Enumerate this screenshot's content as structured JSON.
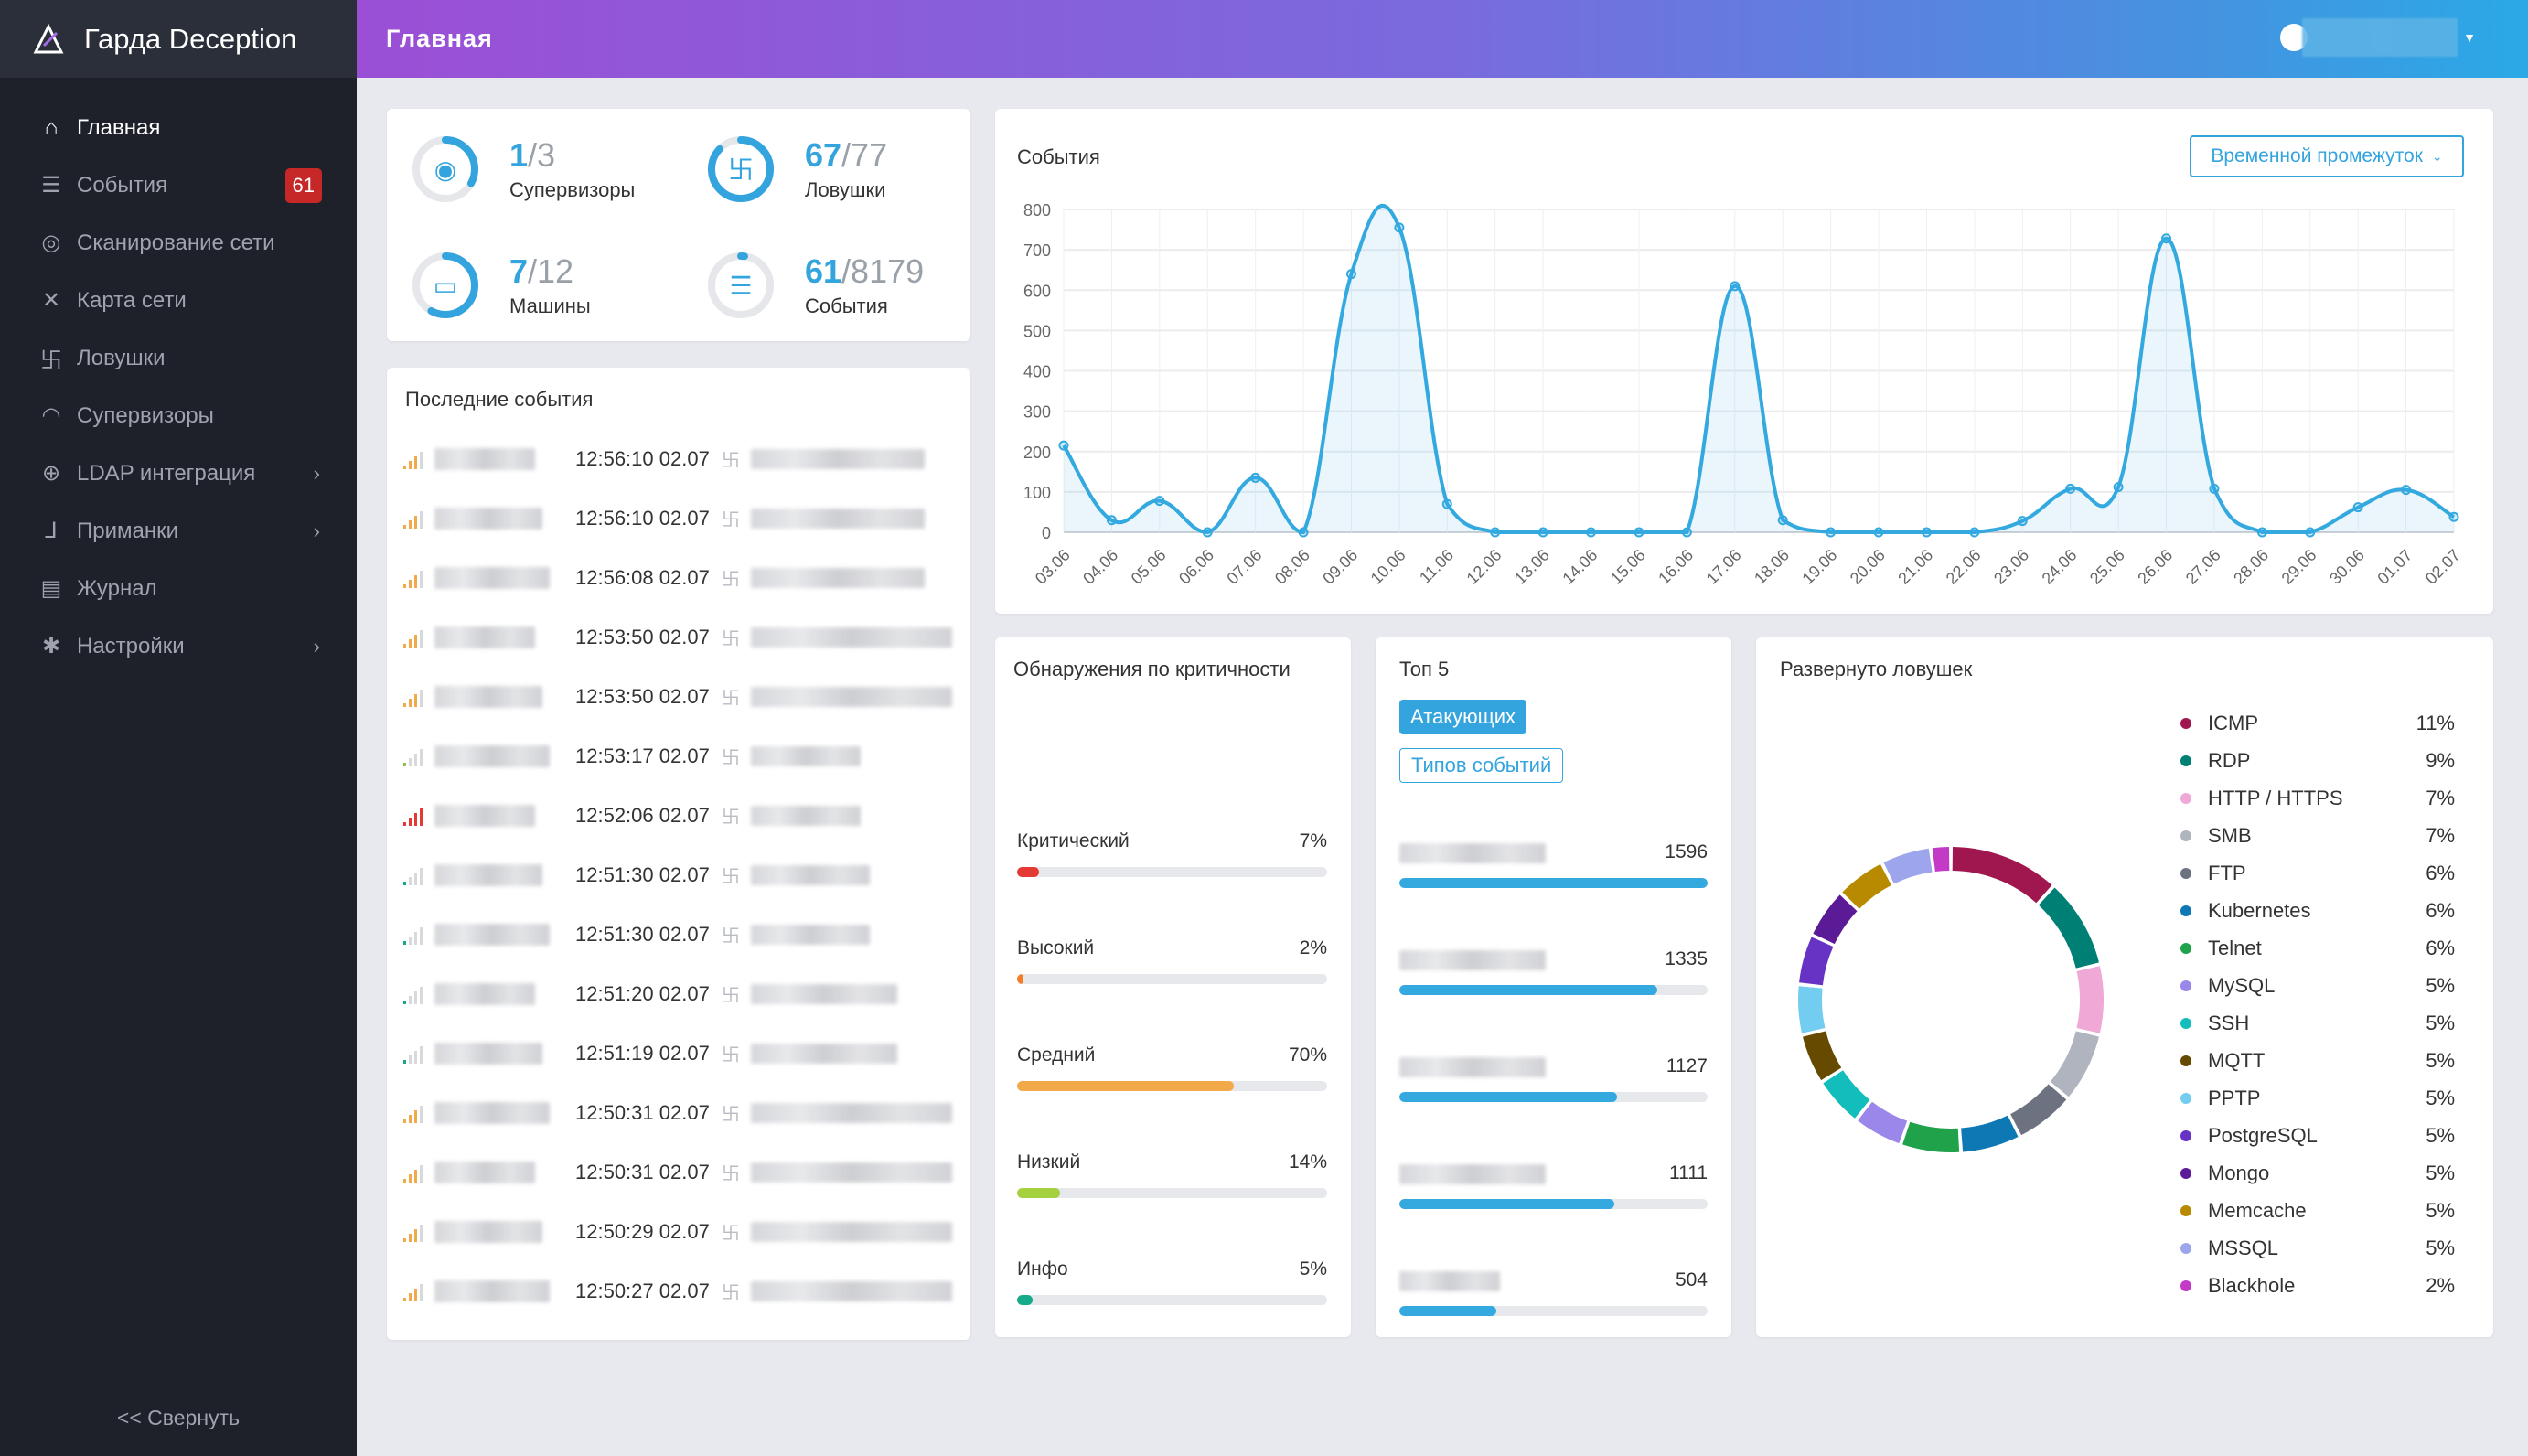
{
  "app": {
    "title": "Гарда Deception"
  },
  "header": {
    "title": "Главная",
    "user_icon": "user-circle-icon"
  },
  "sidebar": {
    "items": [
      {
        "label": "Главная",
        "icon": "home-icon",
        "active": true
      },
      {
        "label": "События",
        "icon": "list-icon",
        "badge": "61"
      },
      {
        "label": "Сканирование сети",
        "icon": "scan-icon"
      },
      {
        "label": "Карта сети",
        "icon": "network-map-icon"
      },
      {
        "label": "Ловушки",
        "icon": "trap-icon"
      },
      {
        "label": "Супервизоры",
        "icon": "signal-icon"
      },
      {
        "label": "LDAP интеграция",
        "icon": "globe-icon",
        "submenu": true
      },
      {
        "label": "Приманки",
        "icon": "hook-icon",
        "submenu": true
      },
      {
        "label": "Журнал",
        "icon": "journal-icon"
      },
      {
        "label": "Настройки",
        "icon": "gear-icon",
        "submenu": true
      }
    ],
    "collapse_label": "<<  Свернуть"
  },
  "stats": [
    {
      "value": "1",
      "total": "/3",
      "label": "Супервизоры",
      "fraction": 0.33
    },
    {
      "value": "67",
      "total": "/77",
      "label": "Ловушки",
      "fraction": 0.87
    },
    {
      "value": "7",
      "total": "/12",
      "label": "Машины",
      "fraction": 0.58
    },
    {
      "value": "61",
      "total": "/8179",
      "label": "События",
      "fraction": 0.01
    }
  ],
  "recent_events": {
    "title": "Последние события",
    "rows": [
      {
        "time": "12:56:10 02.07",
        "severity": "medium"
      },
      {
        "time": "12:56:10 02.07",
        "severity": "medium"
      },
      {
        "time": "12:56:08 02.07",
        "severity": "medium"
      },
      {
        "time": "12:53:50 02.07",
        "severity": "medium"
      },
      {
        "time": "12:53:50 02.07",
        "severity": "medium"
      },
      {
        "time": "12:53:17 02.07",
        "severity": "low"
      },
      {
        "time": "12:52:06 02.07",
        "severity": "critical"
      },
      {
        "time": "12:51:30 02.07",
        "severity": "info"
      },
      {
        "time": "12:51:30 02.07",
        "severity": "info"
      },
      {
        "time": "12:51:20 02.07",
        "severity": "info"
      },
      {
        "time": "12:51:19 02.07",
        "severity": "info"
      },
      {
        "time": "12:50:31 02.07",
        "severity": "medium"
      },
      {
        "time": "12:50:31 02.07",
        "severity": "medium"
      },
      {
        "time": "12:50:29 02.07",
        "severity": "medium"
      },
      {
        "time": "12:50:27 02.07",
        "severity": "medium"
      }
    ]
  },
  "events_chart": {
    "title": "События",
    "range_button": "Временной промежуток"
  },
  "chart_data": {
    "type": "area",
    "x": [
      "03.06",
      "04.06",
      "05.06",
      "06.06",
      "07.06",
      "08.06",
      "09.06",
      "10.06",
      "11.06",
      "12.06",
      "13.06",
      "14.06",
      "15.06",
      "16.06",
      "17.06",
      "18.06",
      "19.06",
      "20.06",
      "21.06",
      "22.06",
      "23.06",
      "24.06",
      "25.06",
      "26.06",
      "27.06",
      "28.06",
      "29.06",
      "30.06",
      "01.07",
      "02.07"
    ],
    "values": [
      215,
      30,
      78,
      0,
      135,
      0,
      640,
      755,
      70,
      0,
      0,
      0,
      0,
      0,
      610,
      30,
      0,
      0,
      0,
      0,
      28,
      108,
      112,
      728,
      108,
      0,
      0,
      62,
      105,
      38
    ],
    "yticks": [
      0,
      100,
      200,
      300,
      400,
      500,
      600,
      700,
      800
    ],
    "ylim": [
      0,
      800
    ],
    "grid": true,
    "color": "#33a9e0"
  },
  "severity": {
    "title": "Обнаружения по критичности",
    "items": [
      {
        "label": "Критический",
        "pct": "7%",
        "value": 7,
        "color": "#e53935"
      },
      {
        "label": "Высокий",
        "pct": "2%",
        "value": 2,
        "color": "#f57c2a"
      },
      {
        "label": "Средний",
        "pct": "70%",
        "value": 70,
        "color": "#f2a94a"
      },
      {
        "label": "Низкий",
        "pct": "14%",
        "value": 14,
        "color": "#a5d13f"
      },
      {
        "label": "Инфо",
        "pct": "5%",
        "value": 5,
        "color": "#16a98a"
      }
    ]
  },
  "top5": {
    "title": "Топ 5",
    "tab_active": "Атакующих",
    "tab_other": "Типов событий",
    "items": [
      {
        "value": "1596"
      },
      {
        "value": "1335"
      },
      {
        "value": "1127"
      },
      {
        "value": "1111"
      },
      {
        "value": "504"
      }
    ],
    "max": 1596
  },
  "traps": {
    "title": "Развернуто ловушек",
    "items": [
      {
        "label": "ICMP",
        "pct": "11%",
        "value": 11,
        "color": "#a0174f"
      },
      {
        "label": "RDP",
        "pct": "9%",
        "value": 9,
        "color": "#007f75"
      },
      {
        "label": "HTTP / HTTPS",
        "pct": "7%",
        "value": 7,
        "color": "#f0a8d6"
      },
      {
        "label": "SMB",
        "pct": "7%",
        "value": 7,
        "color": "#b0b4bf"
      },
      {
        "label": "FTP",
        "pct": "6%",
        "value": 6,
        "color": "#6c7280"
      },
      {
        "label": "Kubernetes",
        "pct": "6%",
        "value": 6,
        "color": "#0e78b4"
      },
      {
        "label": "Telnet",
        "pct": "6%",
        "value": 6,
        "color": "#20a24b"
      },
      {
        "label": "MySQL",
        "pct": "5%",
        "value": 5,
        "color": "#9b86ea"
      },
      {
        "label": "SSH",
        "pct": "5%",
        "value": 5,
        "color": "#12bdbb"
      },
      {
        "label": "MQTT",
        "pct": "5%",
        "value": 5,
        "color": "#654a00"
      },
      {
        "label": "PPTP",
        "pct": "5%",
        "value": 5,
        "color": "#72cdf0"
      },
      {
        "label": "PostgreSQL",
        "pct": "5%",
        "value": 5,
        "color": "#6733c4"
      },
      {
        "label": "Mongo",
        "pct": "5%",
        "value": 5,
        "color": "#5b1a96"
      },
      {
        "label": "Memcache",
        "pct": "5%",
        "value": 5,
        "color": "#b88a00"
      },
      {
        "label": "MSSQL",
        "pct": "5%",
        "value": 5,
        "color": "#9da6ec"
      },
      {
        "label": "Blackhole",
        "pct": "2%",
        "value": 2,
        "color": "#c23ac6"
      }
    ]
  }
}
